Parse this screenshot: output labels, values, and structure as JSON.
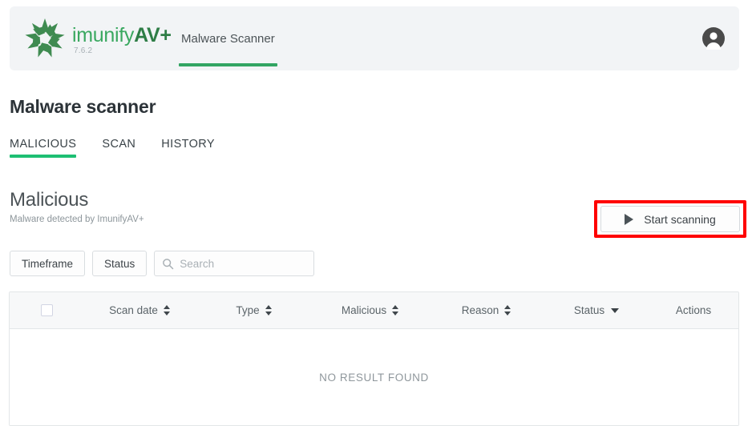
{
  "header": {
    "brand": {
      "logo_icon": "imunify-starburst-logo-icon",
      "name_light": "imunify",
      "name_bold": "AV+",
      "version": "7.6.2",
      "accent_green": "#3aa860"
    },
    "nav": [
      {
        "label": "Malware Scanner",
        "active": true
      }
    ],
    "avatar_icon": "user-avatar-icon",
    "card_bg": "#f2f4f6",
    "active_underline": "#32a563"
  },
  "page": {
    "title": "Malware scanner"
  },
  "tabs": [
    {
      "label": "MALICIOUS",
      "active": true
    },
    {
      "label": "SCAN",
      "active": false
    },
    {
      "label": "HISTORY",
      "active": false
    }
  ],
  "tab_underline_color": "#1dbf73",
  "section": {
    "title": "Malicious",
    "subtitle": "Malware detected by ImunifyAV+"
  },
  "actions": {
    "start_scanning_label": "Start scanning",
    "start_scanning_icon": "play-icon",
    "highlight_color": "#ff0000"
  },
  "filters": {
    "timeframe_label": "Timeframe",
    "status_label": "Status",
    "search_placeholder": "Search",
    "search_value": "",
    "search_icon": "search-icon"
  },
  "table": {
    "select_all_icon": "checkbox-unchecked-icon",
    "columns": [
      {
        "label": "",
        "sort": "none",
        "key": "check"
      },
      {
        "label": "Scan date",
        "sort": "both",
        "key": "scandate"
      },
      {
        "label": "Type",
        "sort": "both",
        "key": "type"
      },
      {
        "label": "Malicious",
        "sort": "both",
        "key": "malicious"
      },
      {
        "label": "Reason",
        "sort": "both",
        "key": "reason"
      },
      {
        "label": "Status",
        "sort": "desc",
        "key": "status"
      },
      {
        "label": "Actions",
        "sort": "none",
        "key": "actions"
      }
    ],
    "rows": [],
    "empty_message": "NO RESULT FOUND"
  }
}
